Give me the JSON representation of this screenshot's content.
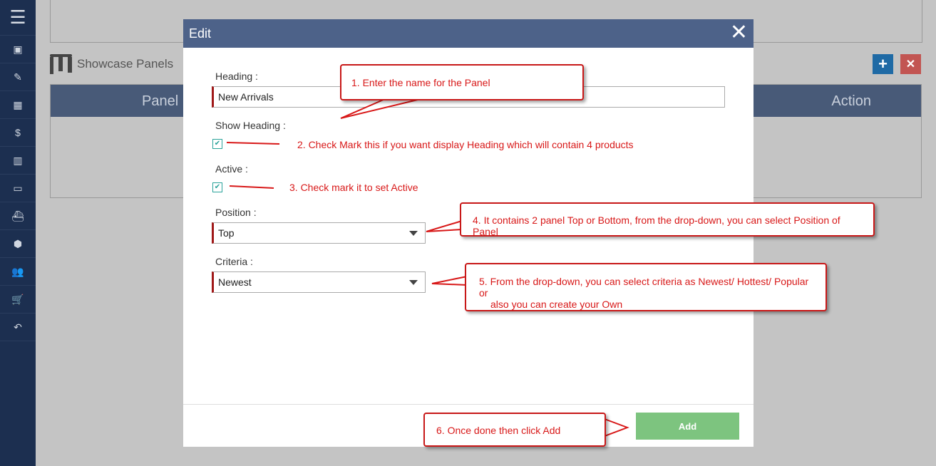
{
  "sidebar": {
    "items": [
      "menu-icon",
      "id-card-icon",
      "edit-list-icon",
      "layout-icon",
      "money-bag-icon",
      "book-icon",
      "ticket-icon",
      "ship-icon",
      "box-icon",
      "users-icon",
      "cart-icon",
      "undo-icon"
    ]
  },
  "page": {
    "title": "Showcase Panels",
    "columns": [
      "Panel",
      "Action"
    ],
    "add_label": "+",
    "delete_label": "✕"
  },
  "modal": {
    "title": "Edit",
    "close": "✕",
    "heading_label": "Heading :",
    "heading_value": "New Arrivals",
    "show_heading_label": "Show Heading :",
    "show_heading_checked": true,
    "active_label": "Active :",
    "active_checked": true,
    "position_label": "Position :",
    "position_value": "Top",
    "criteria_label": "Criteria :",
    "criteria_value": "Newest",
    "add_button": "Add"
  },
  "annotations": {
    "a1": "1. Enter the name for the Panel",
    "a2": "2.  Check Mark this if you want display Heading which will contain 4 products",
    "a3": "3. Check mark it to set Active",
    "a4": "4. It contains 2 panel Top or Bottom, from the drop-down, you can select Position of Panel",
    "a5a": "5. From the drop-down, you can select criteria as Newest/ Hottest/ Popular or",
    "a5b": "also you can create your Own",
    "a6": "6. Once done then click Add"
  },
  "colors": {
    "sidebar": "#1c2f50",
    "modal_header": "#4d6289",
    "add": "#7dc47f",
    "annotation": "#d81818"
  }
}
